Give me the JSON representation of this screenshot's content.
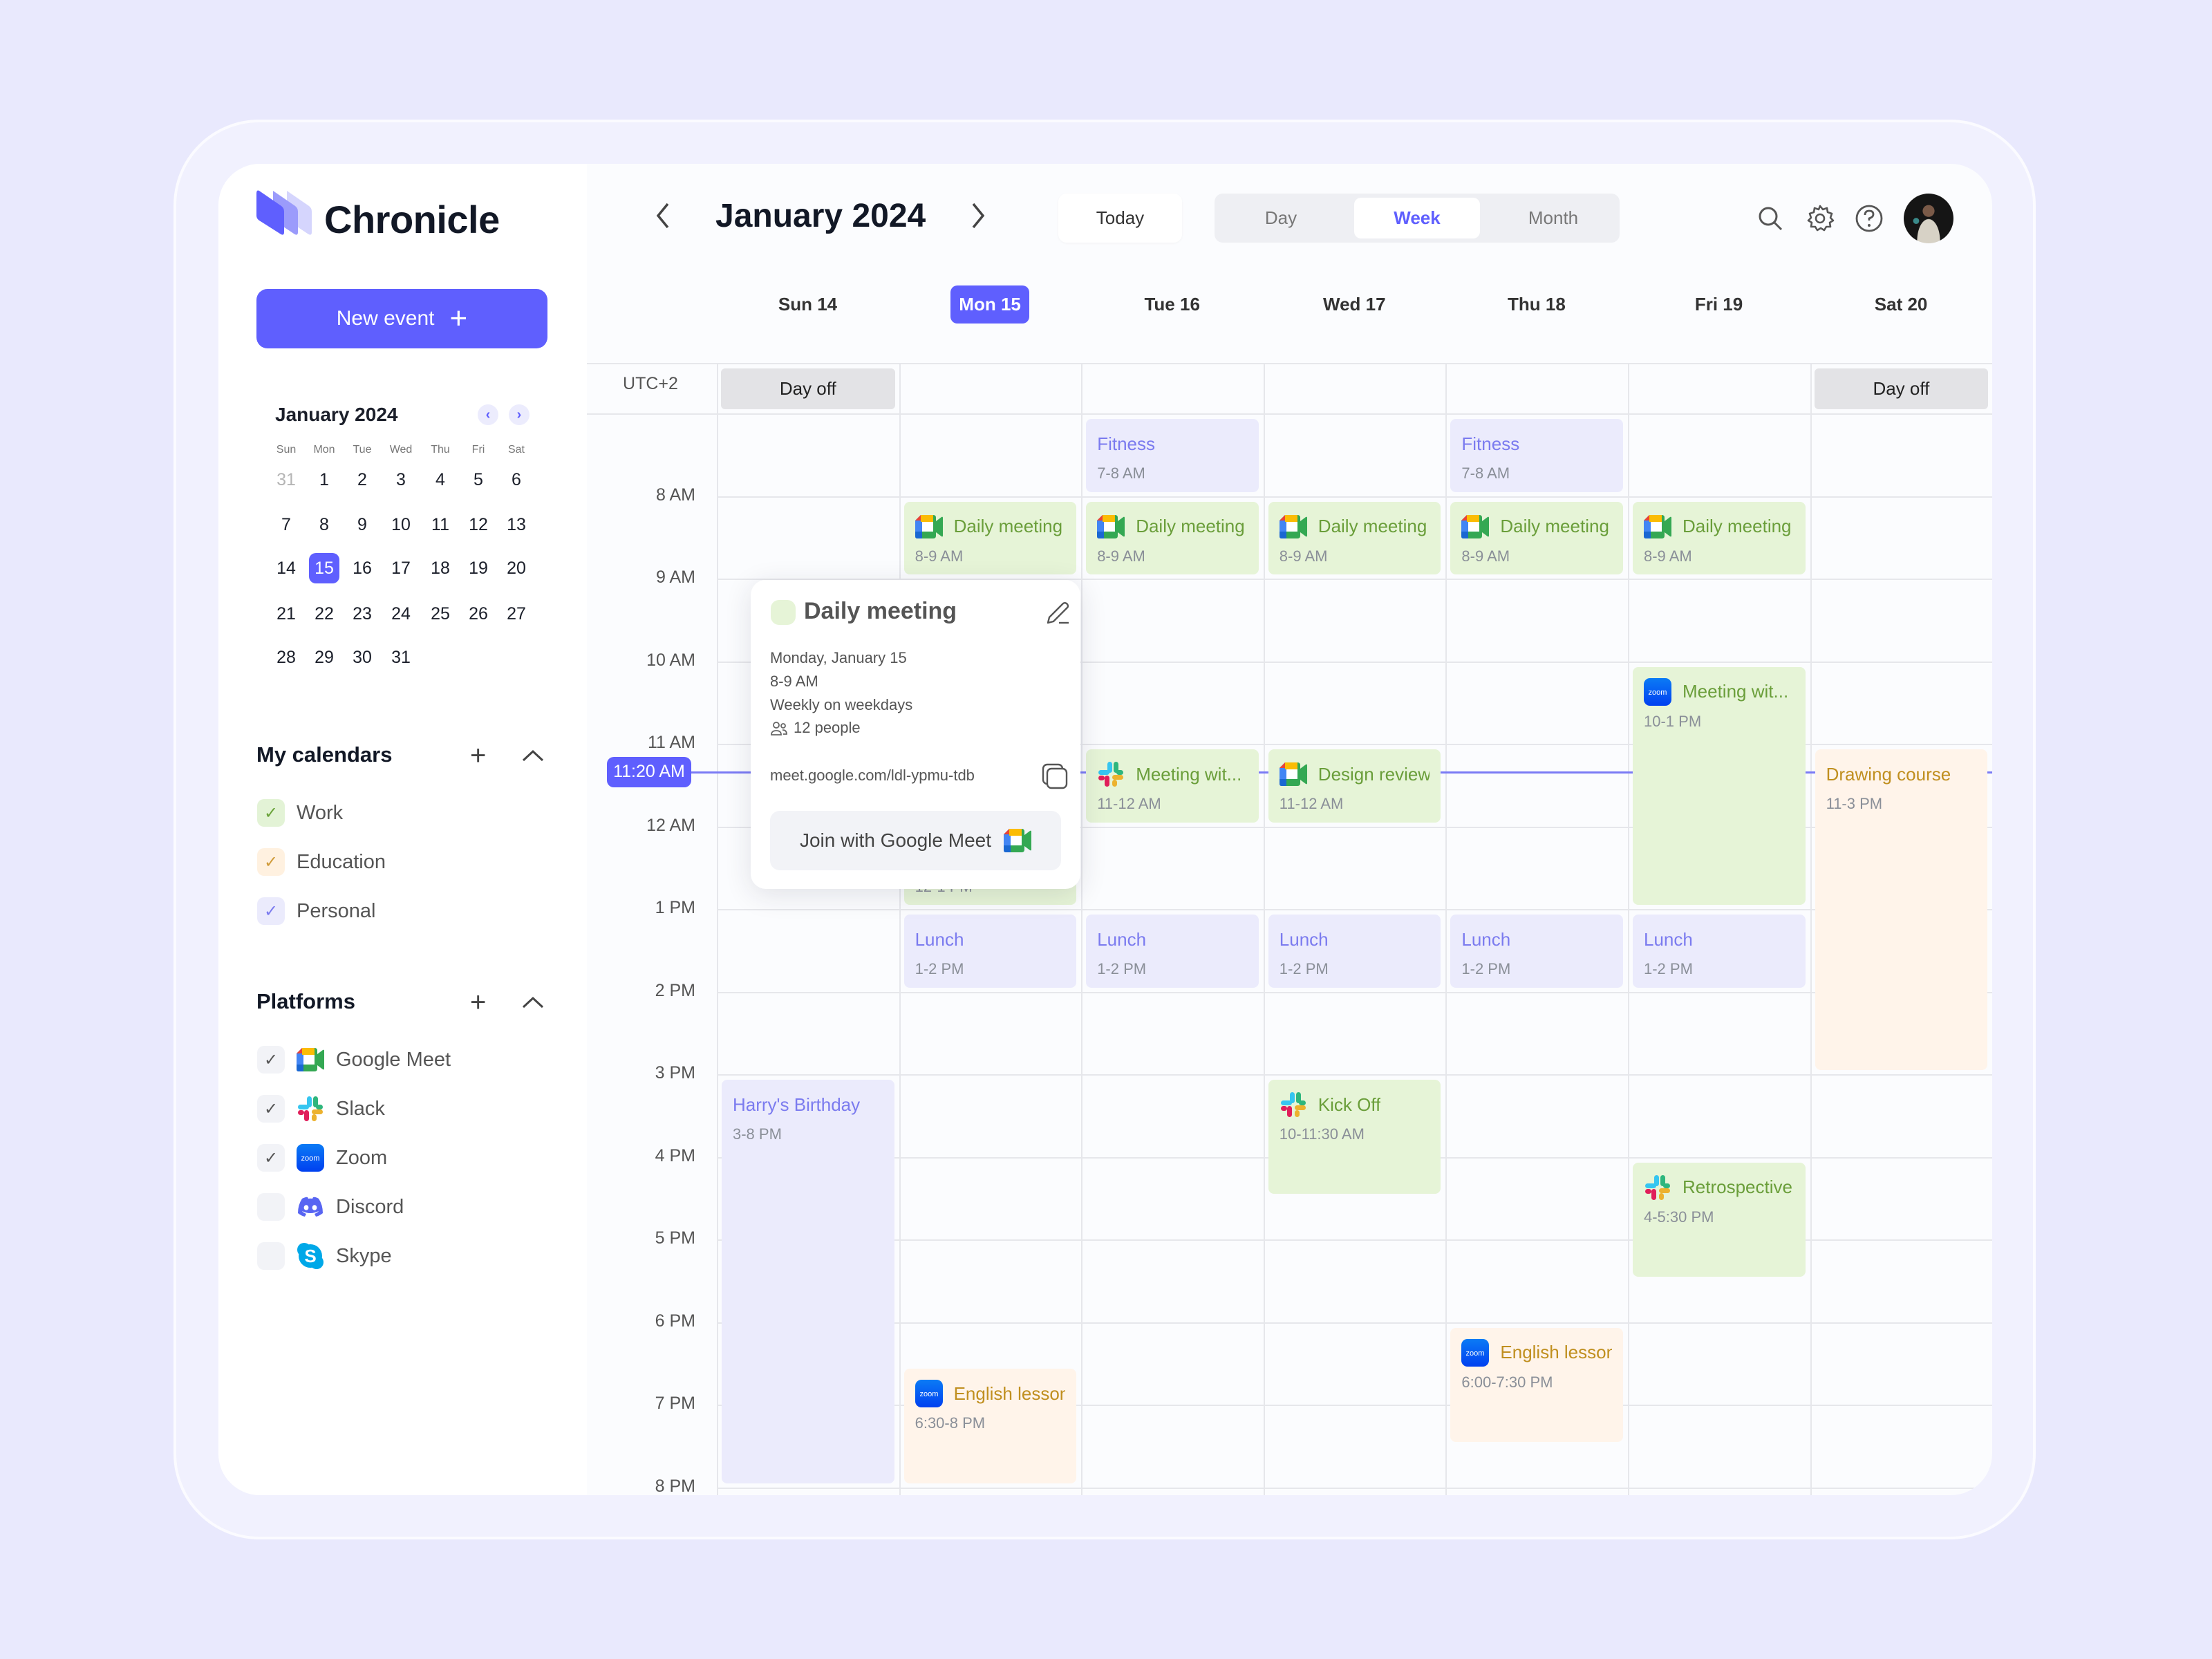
{
  "app": {
    "name": "Chronicle",
    "new_event_label": "New event"
  },
  "mini_calendar": {
    "title": "January 2024",
    "weekdays": [
      "Sun",
      "Mon",
      "Tue",
      "Wed",
      "Thu",
      "Fri",
      "Sat"
    ],
    "weeks": [
      [
        "31",
        "1",
        "2",
        "3",
        "4",
        "5",
        "6"
      ],
      [
        "7",
        "8",
        "9",
        "10",
        "11",
        "12",
        "13"
      ],
      [
        "14",
        "15",
        "16",
        "17",
        "18",
        "19",
        "20"
      ],
      [
        "21",
        "22",
        "23",
        "24",
        "25",
        "26",
        "27"
      ],
      [
        "28",
        "29",
        "30",
        "31",
        "",
        "",
        ""
      ]
    ],
    "muted": [
      "31@0"
    ],
    "selected": "15"
  },
  "my_calendars": {
    "title": "My calendars",
    "items": [
      {
        "label": "Work",
        "checked": true,
        "color": "#6aa33a",
        "bg": "#e3f3d6"
      },
      {
        "label": "Education",
        "checked": true,
        "color": "#d09b3a",
        "bg": "#fff1e0"
      },
      {
        "label": "Personal",
        "checked": true,
        "color": "#7b7bef",
        "bg": "#ebebfc"
      }
    ]
  },
  "platforms": {
    "title": "Platforms",
    "items": [
      {
        "label": "Google Meet",
        "checked": true,
        "icon": "google-meet"
      },
      {
        "label": "Slack",
        "checked": true,
        "icon": "slack"
      },
      {
        "label": "Zoom",
        "checked": true,
        "icon": "zoom"
      },
      {
        "label": "Discord",
        "checked": false,
        "icon": "discord"
      },
      {
        "label": "Skype",
        "checked": false,
        "icon": "skype"
      }
    ]
  },
  "header": {
    "title": "January 2024",
    "today_label": "Today",
    "views": [
      "Day",
      "Week",
      "Month"
    ],
    "active_view": "Week"
  },
  "week": {
    "days": [
      "Sun 14",
      "Mon 15",
      "Tue 16",
      "Wed 17",
      "Thu 18",
      "Fri 19",
      "Sat 20"
    ],
    "today_index": 1,
    "timezone": "UTC+2",
    "hour_labels": [
      "8 AM",
      "9 AM",
      "10 AM",
      "11 AM",
      "12 AM",
      "1 PM",
      "2 PM",
      "3 PM",
      "4 PM",
      "5 PM",
      "6 PM",
      "7 PM",
      "8 PM"
    ],
    "all_day": [
      {
        "day": 0,
        "label": "Day off"
      },
      {
        "day": 6,
        "label": "Day off"
      }
    ],
    "current_time": "11:20 AM",
    "current_time_hours": 11.333
  },
  "events": [
    {
      "day": 2,
      "start": 7,
      "end": 8,
      "title": "Fitness",
      "time": "7-8 AM",
      "color": "purple",
      "icon": ""
    },
    {
      "day": 4,
      "start": 7,
      "end": 8,
      "title": "Fitness",
      "time": "7-8 AM",
      "color": "purple",
      "icon": ""
    },
    {
      "day": 1,
      "start": 8,
      "end": 9,
      "title": "Daily meeting",
      "time": "8-9 AM",
      "color": "green",
      "icon": "google-meet"
    },
    {
      "day": 2,
      "start": 8,
      "end": 9,
      "title": "Daily meeting",
      "time": "8-9 AM",
      "color": "green",
      "icon": "google-meet"
    },
    {
      "day": 3,
      "start": 8,
      "end": 9,
      "title": "Daily meeting",
      "time": "8-9 AM",
      "color": "green",
      "icon": "google-meet"
    },
    {
      "day": 4,
      "start": 8,
      "end": 9,
      "title": "Daily meeting",
      "time": "8-9 AM",
      "color": "green",
      "icon": "google-meet"
    },
    {
      "day": 5,
      "start": 8,
      "end": 9,
      "title": "Daily meeting",
      "time": "8-9 AM",
      "color": "green",
      "icon": "google-meet"
    },
    {
      "day": 5,
      "start": 10,
      "end": 13,
      "title": "Meeting wit...",
      "time": "10-1 PM",
      "color": "green",
      "icon": "zoom"
    },
    {
      "day": 1,
      "start": 12,
      "end": 13,
      "title": "",
      "time": "12-1 PM",
      "color": "green",
      "icon": ""
    },
    {
      "day": 2,
      "start": 11,
      "end": 12,
      "title": "Meeting wit...",
      "time": "11-12 AM",
      "color": "green",
      "icon": "slack"
    },
    {
      "day": 3,
      "start": 11,
      "end": 12,
      "title": "Design review",
      "time": "11-12 AM",
      "color": "green",
      "icon": "google-meet"
    },
    {
      "day": 6,
      "start": 11,
      "end": 15,
      "title": "Drawing course",
      "time": "11-3 PM",
      "color": "orange",
      "icon": ""
    },
    {
      "day": 1,
      "start": 13,
      "end": 14,
      "title": "Lunch",
      "time": "1-2 PM",
      "color": "purple",
      "icon": ""
    },
    {
      "day": 2,
      "start": 13,
      "end": 14,
      "title": "Lunch",
      "time": "1-2 PM",
      "color": "purple",
      "icon": ""
    },
    {
      "day": 3,
      "start": 13,
      "end": 14,
      "title": "Lunch",
      "time": "1-2 PM",
      "color": "purple",
      "icon": ""
    },
    {
      "day": 4,
      "start": 13,
      "end": 14,
      "title": "Lunch",
      "time": "1-2 PM",
      "color": "purple",
      "icon": ""
    },
    {
      "day": 5,
      "start": 13,
      "end": 14,
      "title": "Lunch",
      "time": "1-2 PM",
      "color": "purple",
      "icon": ""
    },
    {
      "day": 0,
      "start": 15,
      "end": 20,
      "title": "Harry's Birthday",
      "time": "3-8 PM",
      "color": "purple",
      "icon": ""
    },
    {
      "day": 3,
      "start": 15,
      "end": 16.5,
      "title": "Kick Off",
      "time": "10-11:30 AM",
      "color": "green",
      "icon": "slack"
    },
    {
      "day": 5,
      "start": 16,
      "end": 17.5,
      "title": "Retrospective",
      "time": "4-5:30 PM",
      "color": "green",
      "icon": "slack"
    },
    {
      "day": 4,
      "start": 18,
      "end": 19.5,
      "title": "English lesson",
      "time": "6:00-7:30 PM",
      "color": "orange",
      "icon": "zoom"
    },
    {
      "day": 1,
      "start": 18.5,
      "end": 20,
      "title": "English lesson",
      "time": "6:30-8 PM",
      "color": "orange",
      "icon": "zoom"
    }
  ],
  "popup": {
    "title": "Daily meeting",
    "date": "Monday, January 15",
    "time": "8-9 AM",
    "recurrence": "Weekly on weekdays",
    "people": "12 people",
    "link": "meet.google.com/ldl-ypmu-tdb",
    "join_label": "Join with Google Meet",
    "color": "#e6f4d7"
  },
  "colors": {
    "accent": "#5f5ffe",
    "green_bg": "#e6f4d7",
    "purple_bg": "#ebebfc",
    "orange_bg": "#fff4ea"
  }
}
